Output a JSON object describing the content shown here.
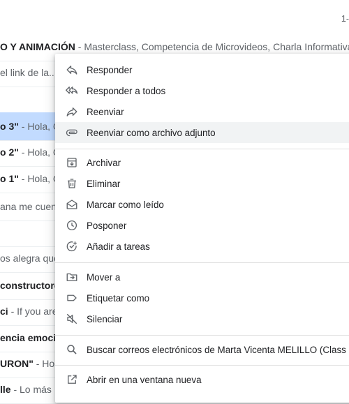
{
  "pager": "1-",
  "list": {
    "rows": [
      {
        "bold": "O Y ANIMACIÓN",
        "preview": " - Masterclass, Competencia de Microvideos, Charla Informativa y S"
      },
      {
        "bold": "",
        "preview": "el link de la...\""
      },
      {
        "bold": "",
        "preview": ""
      },
      {
        "bold": "o 3\"",
        "preview": " - Hola, C"
      },
      {
        "bold": "o 2\"",
        "preview": " - Hola, Cla"
      },
      {
        "bold": "o 1\"",
        "preview": " - Hola, C"
      },
      {
        "bold": "",
        "preview": "ana me cuent"
      },
      {
        "bold": "",
        "preview": ""
      },
      {
        "bold": "",
        "preview": "os alegra que"
      },
      {
        "bold": "constructore",
        "preview": ""
      },
      {
        "bold": "ci",
        "preview": " - If you are"
      },
      {
        "bold": "encia emocio",
        "preview": ""
      },
      {
        "bold": "URON\"",
        "preview": " - Hola,"
      },
      {
        "bold": "lle",
        "preview": " - Lo más"
      }
    ]
  },
  "menu": {
    "group1": [
      {
        "label": "Responder",
        "icon": "reply-icon"
      },
      {
        "label": "Responder a todos",
        "icon": "reply-all-icon"
      },
      {
        "label": "Reenviar",
        "icon": "forward-icon"
      },
      {
        "label": "Reenviar como archivo adjunto",
        "icon": "attachment-icon"
      }
    ],
    "group2": [
      {
        "label": "Archivar",
        "icon": "archive-icon"
      },
      {
        "label": "Eliminar",
        "icon": "trash-icon"
      },
      {
        "label": "Marcar como leído",
        "icon": "mark-read-icon"
      },
      {
        "label": "Posponer",
        "icon": "clock-icon"
      },
      {
        "label": "Añadir a tareas",
        "icon": "add-task-icon"
      }
    ],
    "group3": [
      {
        "label": "Mover a",
        "icon": "move-to-icon"
      },
      {
        "label": "Etiquetar como",
        "icon": "label-icon"
      },
      {
        "label": "Silenciar",
        "icon": "mute-icon"
      }
    ],
    "group4": [
      {
        "label": "Buscar correos electrónicos de Marta Vicenta MELILLO (Class",
        "icon": "search-icon"
      }
    ],
    "group5": [
      {
        "label": "Abrir en una ventana nueva",
        "icon": "open-new-window-icon"
      }
    ]
  }
}
